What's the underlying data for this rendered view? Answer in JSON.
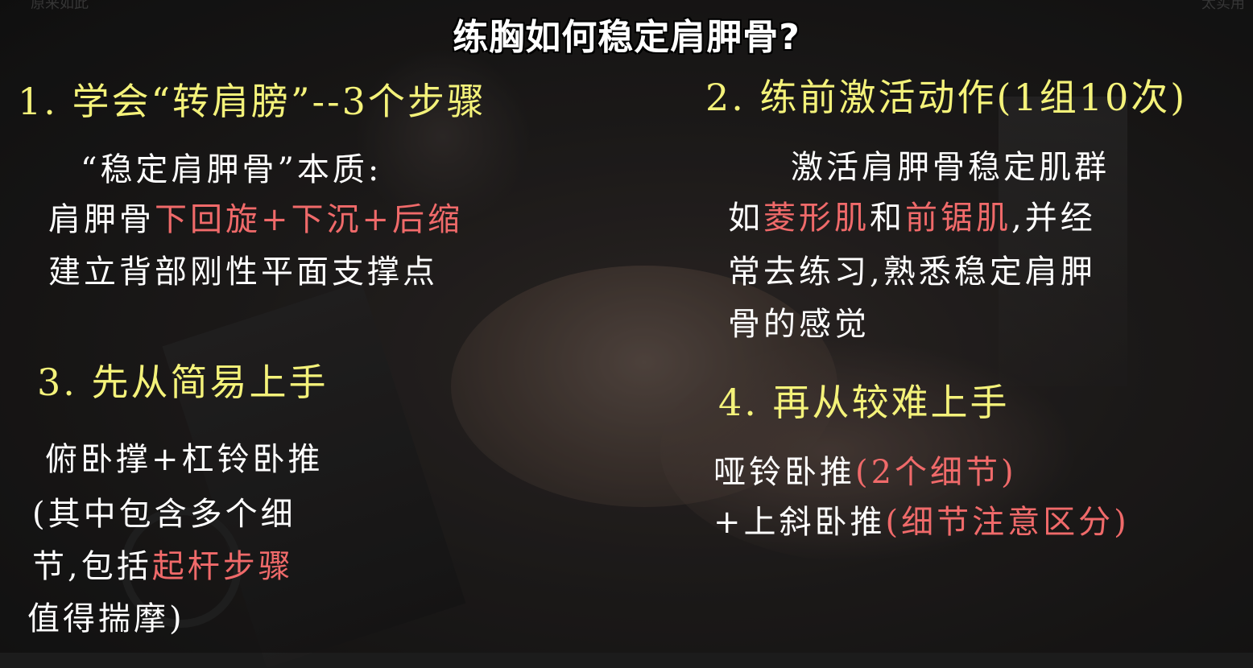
{
  "title": "练胸如何稳定肩胛骨?",
  "watermark": {
    "left": "原来如此",
    "right": "太实用"
  },
  "sections": [
    {
      "heading": "1. 学会“转肩膀”--3个步骤",
      "lines": [
        {
          "parts": [
            "“稳定肩胛骨”本质:"
          ]
        },
        {
          "parts": [
            "肩胛骨",
            "下回旋+下沉+后缩"
          ]
        },
        {
          "parts": [
            "建立背部刚性平面支撑点"
          ]
        }
      ]
    },
    {
      "heading": "2. 练前激活动作(1组10次)",
      "lines": [
        {
          "parts": [
            "激活肩胛骨稳定肌群"
          ]
        },
        {
          "parts": [
            "如",
            "菱形肌",
            "和",
            "前锯肌",
            ",并经"
          ]
        },
        {
          "parts": [
            "常去练习,熟悉稳定肩胛"
          ]
        },
        {
          "parts": [
            "骨的感觉"
          ]
        }
      ]
    },
    {
      "heading": "3. 先从简易上手",
      "lines": [
        {
          "parts": [
            "俯卧撑+杠铃卧推"
          ]
        },
        {
          "parts": [
            "(其中包含多个细"
          ]
        },
        {
          "parts": [
            "节,包括",
            "起杆步骤"
          ]
        },
        {
          "parts": [
            "值得揣摩)"
          ]
        }
      ]
    },
    {
      "heading": "4. 再从较难上手",
      "lines": [
        {
          "parts": [
            "哑铃卧推",
            "(2个细节)"
          ]
        },
        {
          "parts": [
            "+上斜卧推",
            "(细节注意区分)"
          ]
        }
      ]
    }
  ],
  "colors": {
    "heading": "#f4f27a",
    "body": "#ffffff",
    "highlight": "#f06a6a",
    "title": "#ffffff"
  }
}
